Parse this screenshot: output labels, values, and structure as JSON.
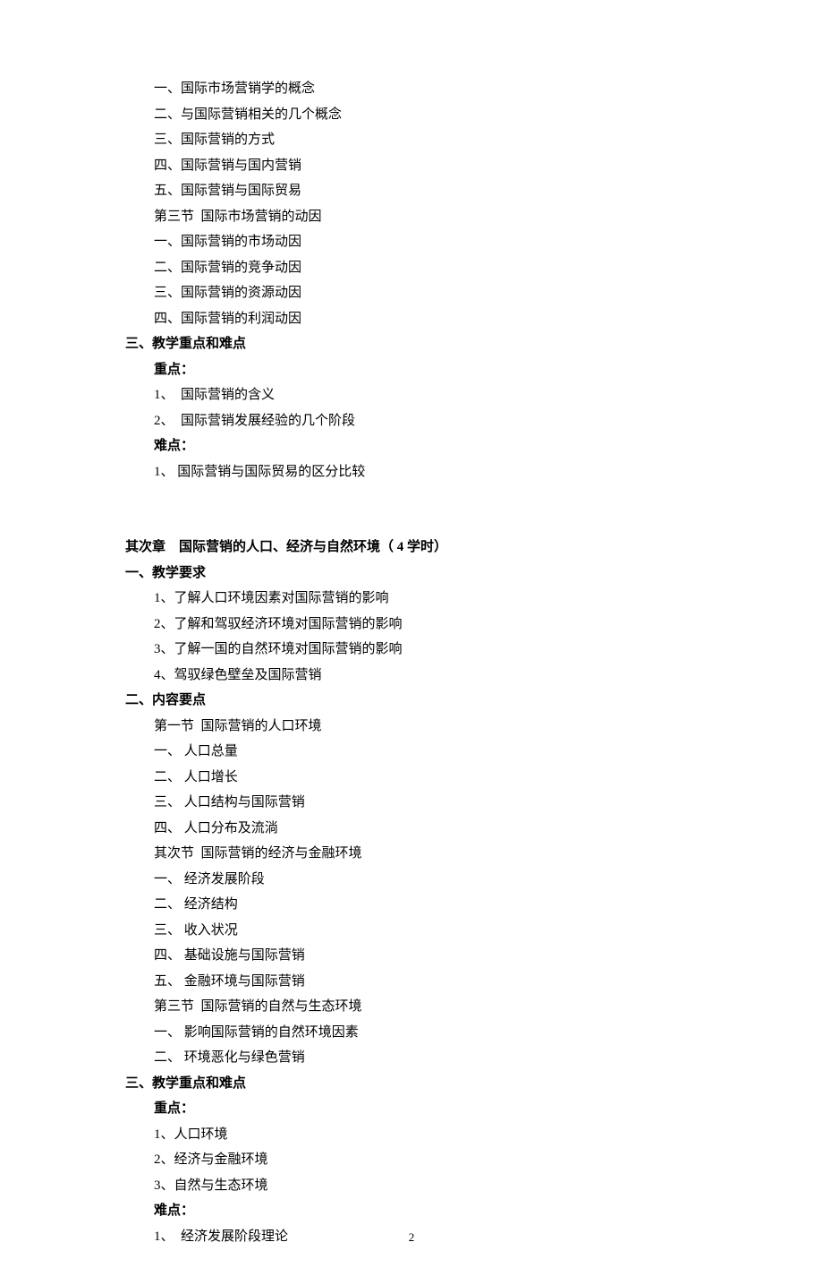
{
  "section1": {
    "items": [
      "一、国际市场营销学的概念",
      "二、与国际营销相关的几个概念",
      "三、国际营销的方式",
      "四、国际营销与国内营销",
      "五、国际营销与国际贸易",
      "第三节  国际市场营销的动因",
      "一、国际营销的市场动因",
      "二、国际营销的竞争动因",
      "三、国际营销的资源动因",
      "四、国际营销的利润动因"
    ]
  },
  "section2": {
    "heading": "三、教学重点和难点",
    "emphasis_label": "重点：",
    "emphasis_items": [
      "1、  国际营销的含义",
      "2、  国际营销发展经验的几个阶段"
    ],
    "difficulty_label": "难点：",
    "difficulty_items": [
      "1、 国际营销与国际贸易的区分比较"
    ]
  },
  "chapter2": {
    "title": "其次章    国际营销的人口、经济与自然环境（ 4 学时）",
    "req_heading": "一、教学要求",
    "req_items": [
      "1、了解人口环境因素对国际营销的影响",
      "2、了解和驾驭经济环境对国际营销的影响",
      "3、了解一国的自然环境对国际营销的影响",
      "4、驾驭绿色壁垒及国际营销"
    ],
    "content_heading": "二、内容要点",
    "content_items": [
      "第一节  国际营销的人口环境",
      "一、 人口总量",
      "二、 人口增长",
      "三、 人口结构与国际营销",
      "四、 人口分布及流淌",
      "其次节  国际营销的经济与金融环境",
      "一、 经济发展阶段",
      "二、 经济结构",
      "三、 收入状况",
      "四、 基础设施与国际营销",
      "五、 金融环境与国际营销",
      "第三节  国际营销的自然与生态环境",
      "一、 影响国际营销的自然环境因素",
      "二、 环境恶化与绿色营销"
    ],
    "kd_heading": "三、教学重点和难点",
    "kd_emphasis_label": "重点：",
    "kd_emphasis_items": [
      "1、人口环境",
      "2、经济与金融环境",
      "3、自然与生态环境"
    ],
    "kd_difficulty_label": "难点：",
    "kd_difficulty_items": [
      "1、  经济发展阶段理论"
    ]
  },
  "page_number": "2"
}
